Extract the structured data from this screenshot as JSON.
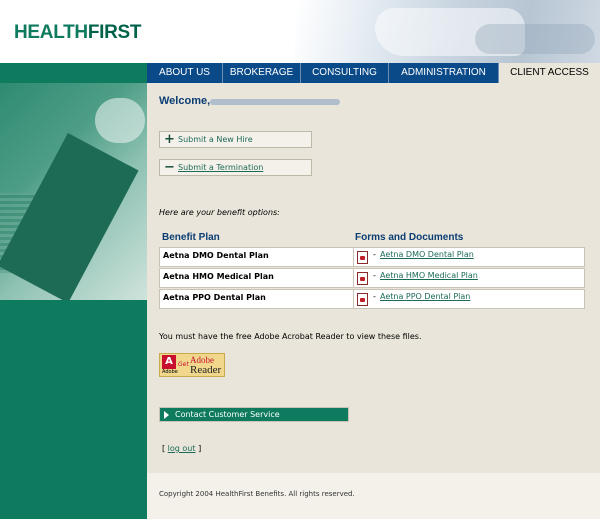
{
  "brand": {
    "logo_part1": "HEALTH",
    "logo_part2": "FIRST"
  },
  "nav": {
    "items": [
      {
        "label": "ABOUT US",
        "active": false
      },
      {
        "label": "BROKERAGE",
        "active": false
      },
      {
        "label": "CONSULTING",
        "active": false
      },
      {
        "label": "ADMINISTRATION",
        "active": false
      },
      {
        "label": "CLIENT ACCESS",
        "active": true
      }
    ]
  },
  "main": {
    "welcome": "Welcome,",
    "actions": {
      "new_hire_symbol": "+",
      "new_hire_label": "Submit a New Hire",
      "termination_symbol": "−",
      "termination_label": "Submit a Termination"
    },
    "options_text": "Here are your benefit options:",
    "table": {
      "header_plan": "Benefit Plan",
      "header_forms": "Forms and Documents",
      "dash": "-",
      "rows": [
        {
          "plan": "Aetna DMO Dental Plan",
          "doc": "Aetna DMO Dental Plan"
        },
        {
          "plan": "Aetna HMO Medical Plan",
          "doc": "Aetna HMO Medical Plan"
        },
        {
          "plan": "Aetna PPO Dental Plan",
          "doc": "Aetna PPO Dental Plan"
        }
      ]
    },
    "acrobat_text": "You must have the free Adobe Acrobat Reader to view these files.",
    "adobe_badge": {
      "letter": "A",
      "adobe_word": "Adobe",
      "get": "Get",
      "adobe": "Adobe",
      "reader": "Reader"
    },
    "contact_label": "Contact Customer Service",
    "logout": {
      "open": "[",
      "label": "log out",
      "close": "]"
    }
  },
  "footer": {
    "copyright": "Copyright 2004 HealthFirst Benefits.  All rights reserved."
  },
  "colors": {
    "green": "#0e7a5e",
    "navy": "#0b4a88",
    "beige": "#e9e5da",
    "link": "#1c6a58"
  }
}
